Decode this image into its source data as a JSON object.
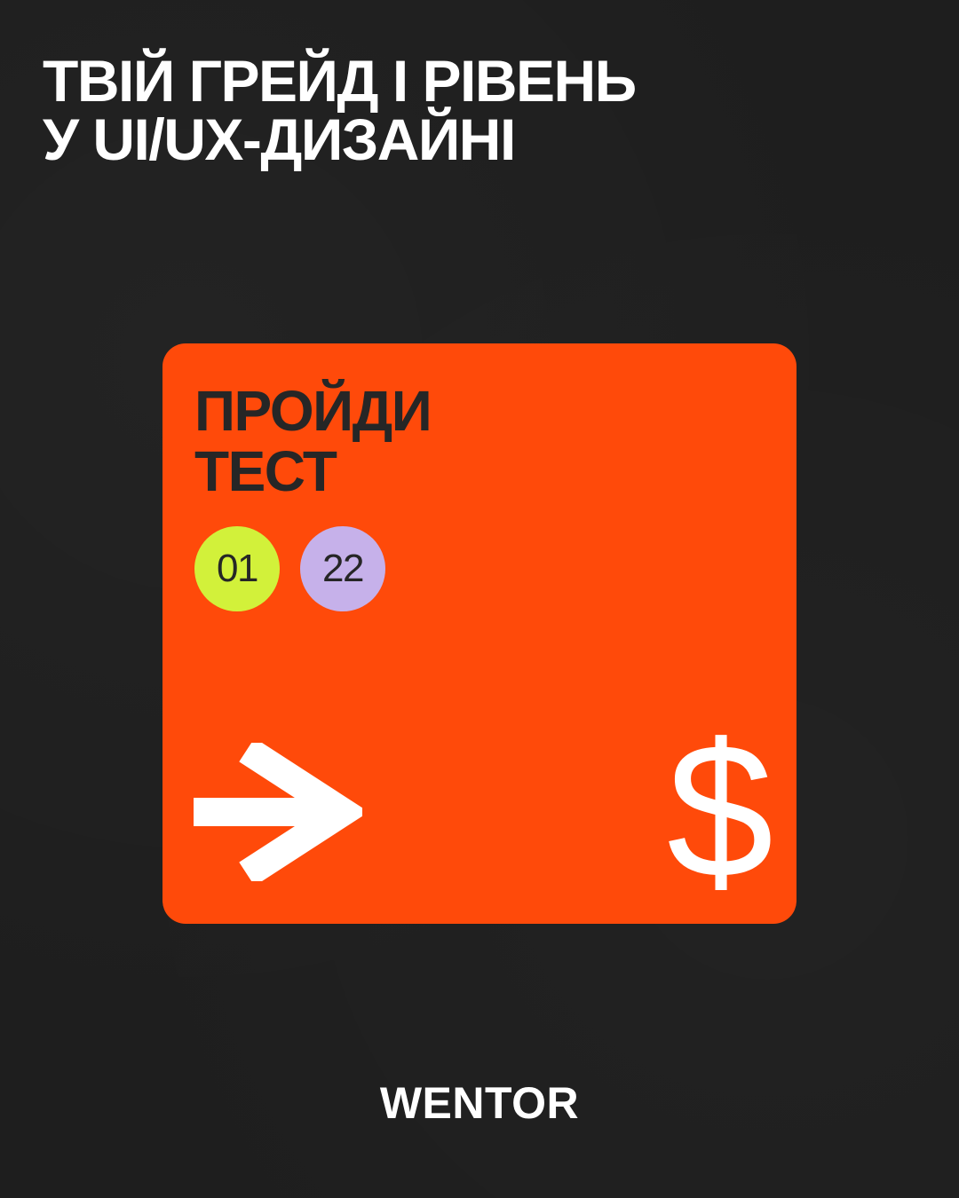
{
  "headline": {
    "line1": "ТВІЙ ГРЕЙД І РІВЕНЬ",
    "line2": "У UI/UX-ДИЗАЙНІ"
  },
  "card": {
    "title_line1": "ПРОЙДИ",
    "title_line2": "ТЕСТ",
    "badges": [
      {
        "text": "01",
        "color": "#d2f13a"
      },
      {
        "text": "22",
        "color": "#c6b1ea"
      }
    ],
    "arrow_icon": "arrow-right-icon",
    "currency_symbol": "$",
    "color": "#ff4a0a"
  },
  "brand": {
    "logo": "WENTOR"
  },
  "colors": {
    "background": "#1e1e1e",
    "text_light": "#ffffff",
    "text_dark": "#262626"
  }
}
